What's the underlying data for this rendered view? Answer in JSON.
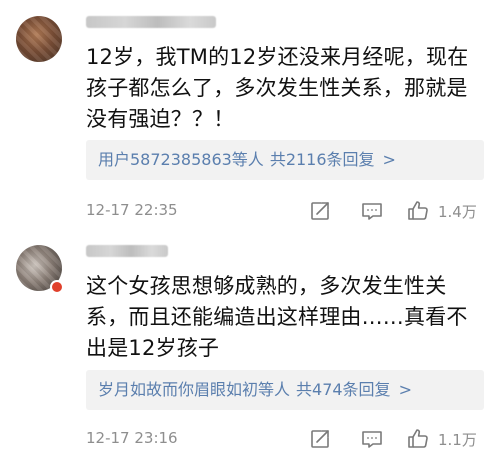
{
  "comments": [
    {
      "text": "12岁，我TM的12岁还没来月经呢，现在孩子都怎么了，多次发生性关系，那就是没有强迫？？！",
      "reply_summary": "用户5872385863等人",
      "reply_count": "共2116条回复",
      "chevron": ">",
      "time": "12-17 22:35",
      "likes": "1.4万"
    },
    {
      "text": "这个女孩思想够成熟的，多次发生性关系，而且还能编造出这样理由……真看不出是12岁孩子",
      "reply_summary": "岁月如故而你眉眼如初等人",
      "reply_count": "共474条回复",
      "chevron": ">",
      "time": "12-17 23:16",
      "likes": "1.1万"
    }
  ],
  "icons": {
    "share": "share-icon",
    "comment": "comment-icon",
    "like": "thumbs-up-icon"
  },
  "colors": {
    "link": "#5b7fae",
    "meta": "#8e8e8e",
    "reply_bg": "#f2f2f2"
  }
}
